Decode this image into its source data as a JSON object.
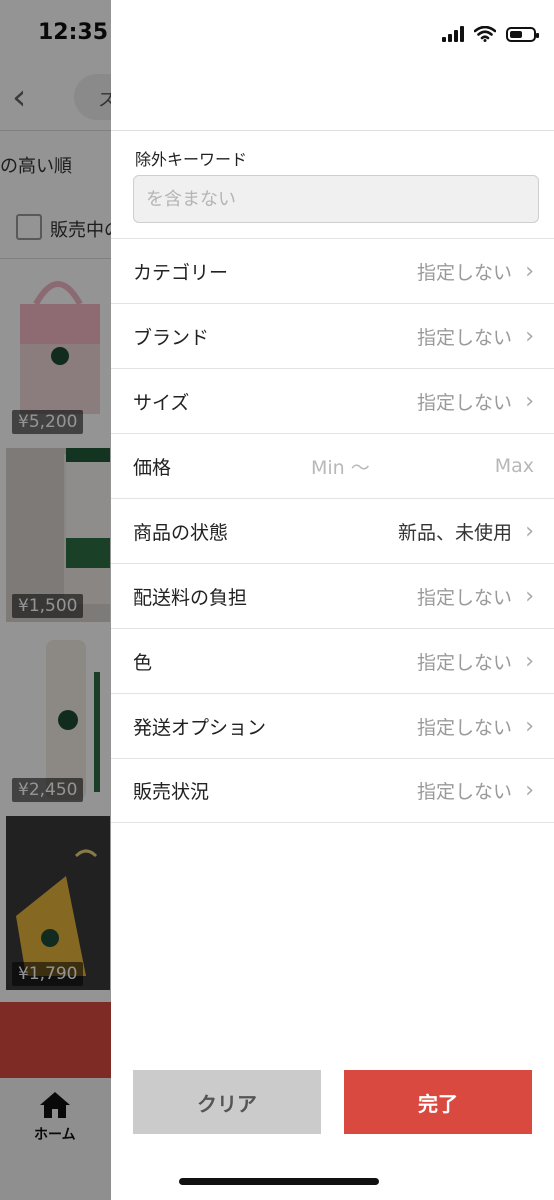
{
  "status_bar": {
    "time": "12:35"
  },
  "background": {
    "search_text": "ス",
    "sort_label": "の高い順",
    "on_sale_label": "販売中の",
    "items": [
      {
        "price": "¥5,200"
      },
      {
        "price": "¥1,500"
      },
      {
        "price": "¥2,450"
      },
      {
        "price": "¥1,790"
      }
    ],
    "tab_home_label": "ホーム"
  },
  "filter": {
    "exclude_keyword_label": "除外キーワード",
    "exclude_keyword_placeholder": "を含まない",
    "exclude_keyword_value": "",
    "rows": {
      "category": {
        "label": "カテゴリー",
        "value": "指定しない"
      },
      "brand": {
        "label": "ブランド",
        "value": "指定しない"
      },
      "size": {
        "label": "サイズ",
        "value": "指定しない"
      },
      "price": {
        "label": "価格",
        "min_placeholder": "Min 〜",
        "max_placeholder": "Max"
      },
      "condition": {
        "label": "商品の状態",
        "value": "新品、未使用"
      },
      "shipping_fee": {
        "label": "配送料の負担",
        "value": "指定しない"
      },
      "color": {
        "label": "色",
        "value": "指定しない"
      },
      "shipping_option": {
        "label": "発送オプション",
        "value": "指定しない"
      },
      "sale_status": {
        "label": "販売状況",
        "value": "指定しない"
      }
    },
    "chevron": "›",
    "clear_button": "クリア",
    "done_button": "完了"
  },
  "colors": {
    "accent": "#d9493f",
    "clear_bg": "#cbcbcb"
  }
}
